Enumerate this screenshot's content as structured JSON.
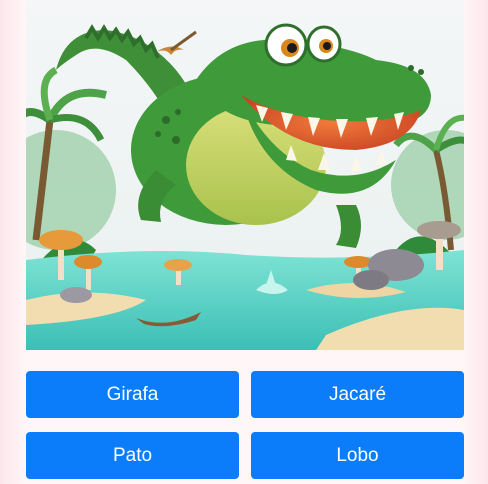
{
  "quiz": {
    "image": {
      "subject": "crocodile-illustration",
      "colors": {
        "sky": "#f2f5f6",
        "water": "#5fd6c8",
        "sand": "#f3dfb0",
        "croc_green": "#3f9a3a",
        "croc_belly": "#c9d96a",
        "mouth": "#e8642f"
      }
    },
    "options": [
      {
        "label": "Girafa"
      },
      {
        "label": "Jacaré"
      },
      {
        "label": "Pato"
      },
      {
        "label": "Lobo"
      }
    ],
    "button_color": "#0b7dfb",
    "button_text_color": "#ffffff"
  }
}
